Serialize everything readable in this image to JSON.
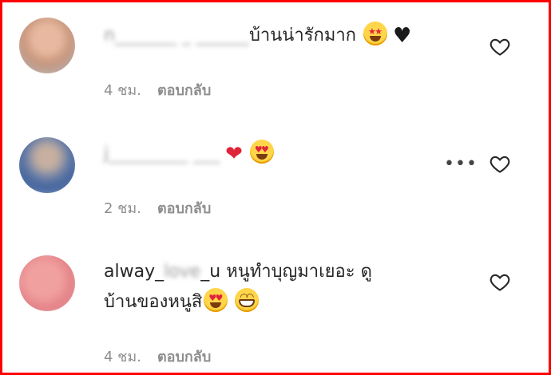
{
  "comments": [
    {
      "username": "n_______ _ ______",
      "text": "บ้านน่ารักมาก",
      "emojis": [
        "star-struck-emoji",
        "black-heart-emoji"
      ],
      "time": "4 ชม.",
      "reply": "ตอบกลับ"
    },
    {
      "username": "j_________ ___",
      "text": "",
      "emojis": [
        "red-heart-emoji",
        "heart-eyes-emoji"
      ],
      "time": "2 ชม.",
      "reply": "ตอบกลับ"
    },
    {
      "username_visible": "alway_",
      "username_blurred": "love",
      "username_tail": "_u",
      "text": "หนูทำบุญมาเยอะ ดู",
      "text_line2": "บ้านของหนูสิ",
      "emojis": [
        "heart-eyes-emoji",
        "grinning-emoji"
      ],
      "time": "4 ชม.",
      "reply": "ตอบกลับ"
    }
  ],
  "colors": {
    "frame": "#ff0000",
    "text": "#262626",
    "meta": "#8e8e8e"
  },
  "more_label": "•••"
}
